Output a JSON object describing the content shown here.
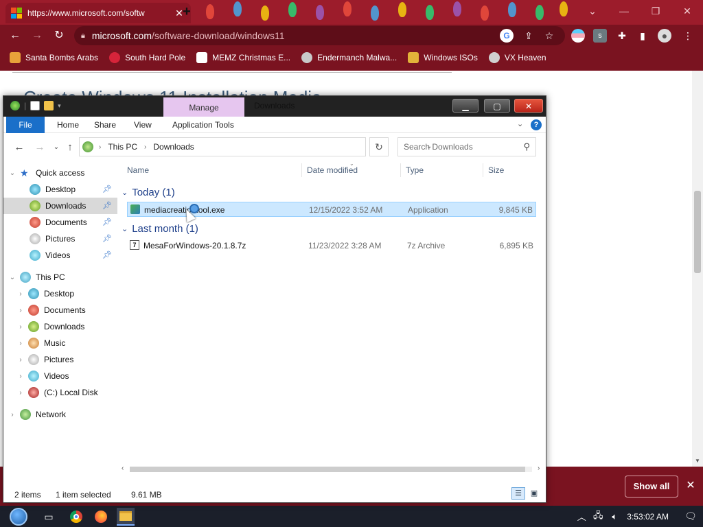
{
  "browser": {
    "tab_title": "https://www.microsoft.com/softw",
    "tab_close": "✕",
    "new_tab": "+",
    "url_host": "microsoft.com",
    "url_path": "/software-download/windows11",
    "window_controls": {
      "tabsearch": "⌄",
      "minimize": "—",
      "restore": "❐",
      "close": "✕"
    },
    "bookmarks": [
      {
        "label": "Santa Bombs Arabs",
        "color": "#e8a13a"
      },
      {
        "label": "South Hard Pole",
        "color": "#d6243a"
      },
      {
        "label": "MEMZ Christmas E...",
        "color": "#ffffff"
      },
      {
        "label": "Endermanch Malwa...",
        "color": "#c9c9c9"
      },
      {
        "label": "Windows ISOs",
        "color": "#e2b23a"
      },
      {
        "label": "VX Heaven",
        "color": "#d0d0d0"
      }
    ],
    "accent": "#7a1320"
  },
  "webpage": {
    "heading": "Create Windows 11 Installation Media"
  },
  "downloadbar": {
    "show_all": "Show all",
    "close": "✕"
  },
  "explorer": {
    "title": "Downloads",
    "manage_tab": "Manage",
    "ribbon_tabs": [
      "File",
      "Home",
      "Share",
      "View",
      "Application Tools"
    ],
    "help": "?",
    "breadcrumbs": [
      "This PC",
      "Downloads"
    ],
    "search_placeholder": "Search Downloads",
    "nav": {
      "quick_access": "Quick access",
      "quick_items": [
        "Desktop",
        "Downloads",
        "Documents",
        "Pictures",
        "Videos"
      ],
      "this_pc": "This PC",
      "pc_items": [
        "Desktop",
        "Documents",
        "Downloads",
        "Music",
        "Pictures",
        "Videos",
        "(C:) Local Disk"
      ],
      "network": "Network"
    },
    "columns": [
      "Name",
      "Date modified",
      "Type",
      "Size"
    ],
    "groups": [
      {
        "label": "Today (1)",
        "files": [
          {
            "name": "mediacreationtool.exe",
            "date": "12/15/2022 3:52 AM",
            "type": "Application",
            "size": "9,845 KB",
            "selected": true
          }
        ]
      },
      {
        "label": "Last month (1)",
        "files": [
          {
            "name": "MesaForWindows-20.1.8.7z",
            "date": "11/23/2022 3:28 AM",
            "type": "7z Archive",
            "size": "6,895 KB",
            "selected": false
          }
        ]
      }
    ],
    "status": {
      "items": "2 items",
      "selected": "1 item selected",
      "size": "9.61 MB"
    }
  },
  "taskbar": {
    "clock": "3:53:02 AM"
  }
}
